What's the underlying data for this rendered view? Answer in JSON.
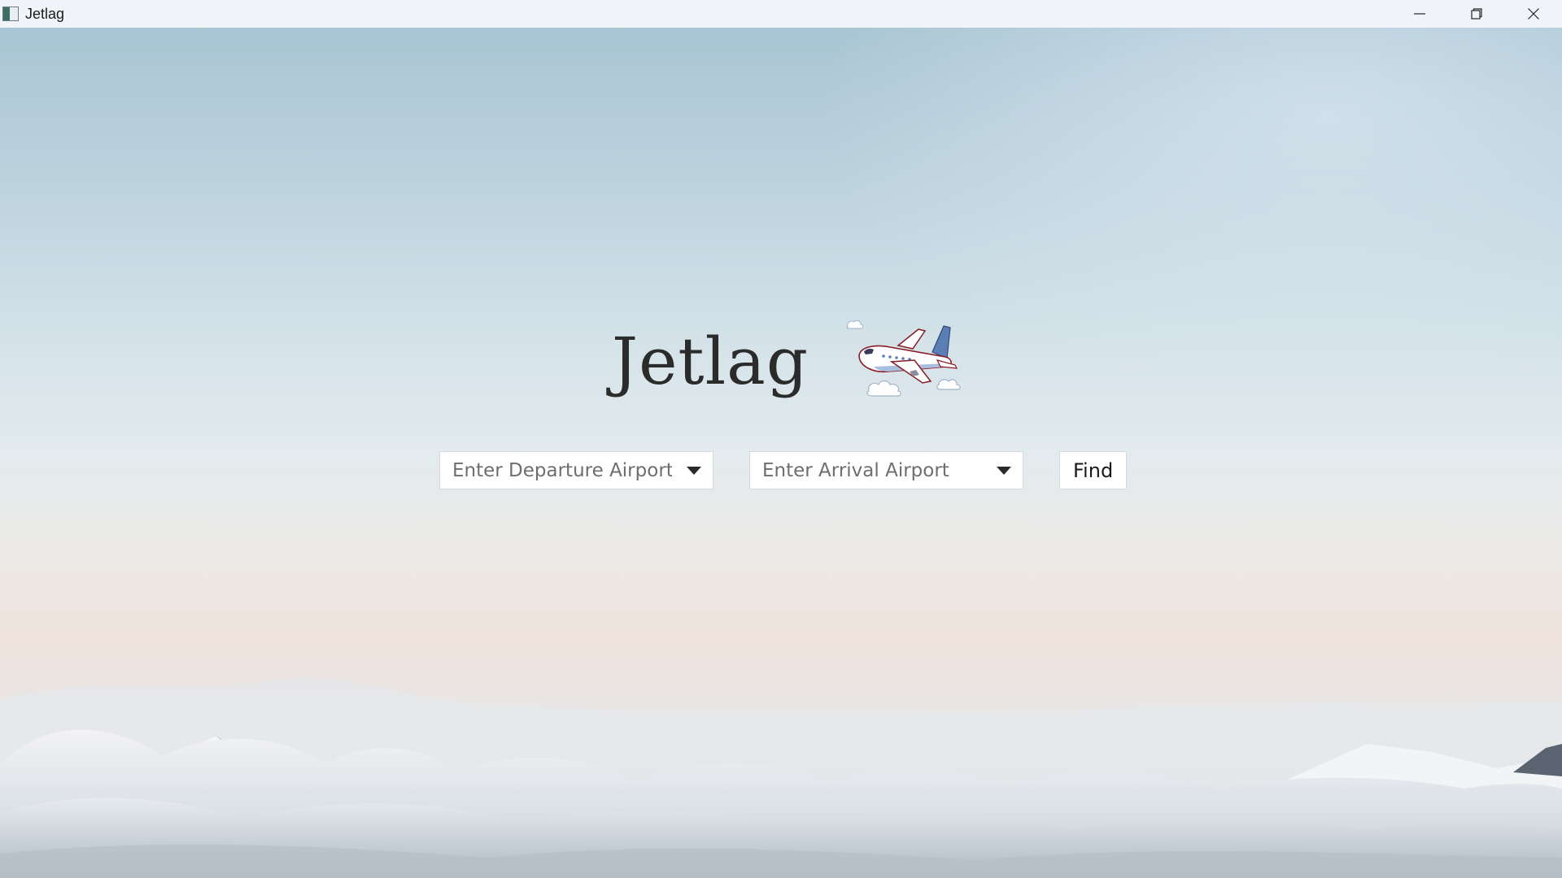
{
  "window": {
    "title": "Jetlag",
    "app_icon": "app-window-icon",
    "controls": {
      "minimize_icon": "minimize-icon",
      "restore_icon": "restore-icon",
      "close_icon": "close-icon"
    }
  },
  "brand": {
    "title": "Jetlag",
    "logo_icon": "airplane-icon"
  },
  "search": {
    "departure": {
      "value": "",
      "placeholder": "Enter Departure Airport"
    },
    "arrival": {
      "value": "",
      "placeholder": "Enter Arrival Airport"
    },
    "find_label": "Find"
  },
  "colors": {
    "title_text": "#2b2b2b",
    "plane_body": "#ffffff",
    "plane_tail": "#5b7fb5",
    "plane_outline": "#8a1c24"
  }
}
